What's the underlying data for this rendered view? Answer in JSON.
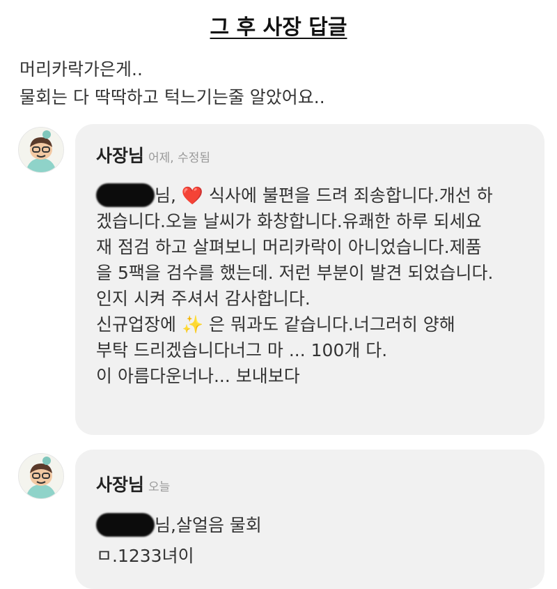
{
  "page": {
    "title": "그 후 사장 답글"
  },
  "review": {
    "lines": [
      "머리카락가은게..",
      "물회는 다 딱딱하고 턱느기는줄 알았어요.."
    ]
  },
  "replies": [
    {
      "sender": "사장님",
      "meta": "어제, 수정됨",
      "lines": [
        "님, ❤️ 식사에 불편을 드려 죄송합니다.개선 하",
        "겠습니다.오늘 날씨가 화창합니다.유쾌한 하루 되세요",
        "재 점검 하고 살펴보니 머리카락이 아니었습니다.제품",
        "을 5팩을 검수를 했는데. 저런 부분이 발견 되었습니다.",
        "인지 시켜 주셔서 감사합니다.",
        "신규업장에 ✨ 은 뭐과도 같습니다.너그러히 양해",
        "부탁 드리겠습니다너그 마 ... 100개 다.",
        "이 아름다운너나... 보내보다"
      ]
    },
    {
      "sender": "사장님",
      "meta": "오늘",
      "lines": [
        "님,살얼음 물회",
        "ㅁ.1233녀이"
      ]
    }
  ],
  "colors": {
    "bubble": "#f1f1f1",
    "heart": "#e03a4a",
    "star": "#f2c14e",
    "meta": "#999999"
  }
}
